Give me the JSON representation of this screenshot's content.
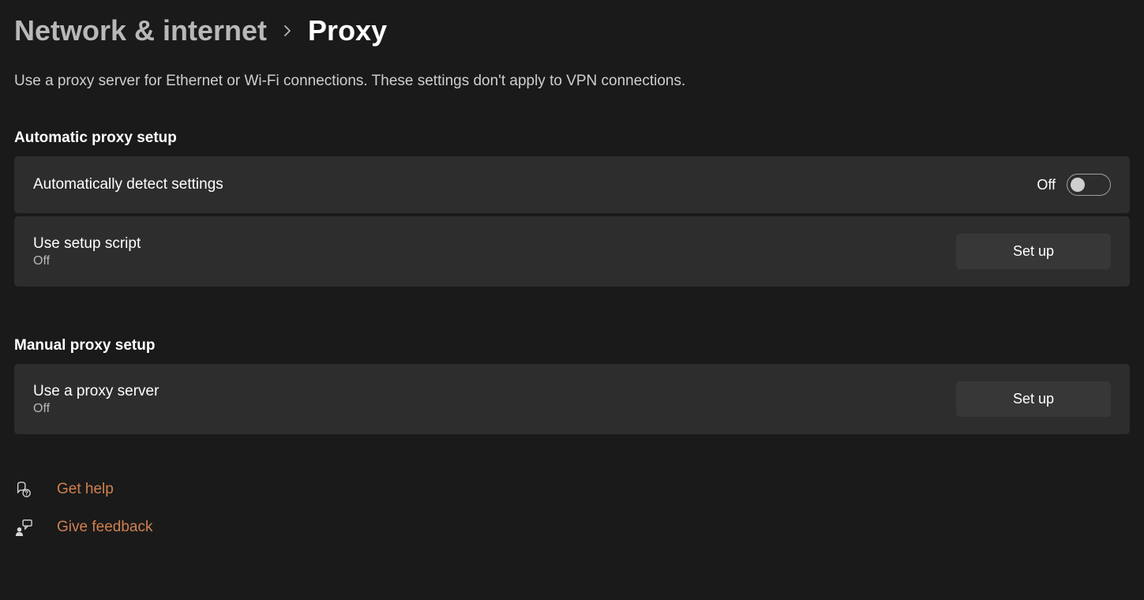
{
  "breadcrumb": {
    "parent": "Network & internet",
    "current": "Proxy"
  },
  "description": "Use a proxy server for Ethernet or Wi-Fi connections. These settings don't apply to VPN connections.",
  "sections": {
    "automatic": {
      "title": "Automatic proxy setup",
      "detect": {
        "label": "Automatically detect settings",
        "toggle_state": "Off"
      },
      "script": {
        "label": "Use setup script",
        "status": "Off",
        "button": "Set up"
      }
    },
    "manual": {
      "title": "Manual proxy setup",
      "server": {
        "label": "Use a proxy server",
        "status": "Off",
        "button": "Set up"
      }
    }
  },
  "footer": {
    "help": "Get help",
    "feedback": "Give feedback"
  }
}
